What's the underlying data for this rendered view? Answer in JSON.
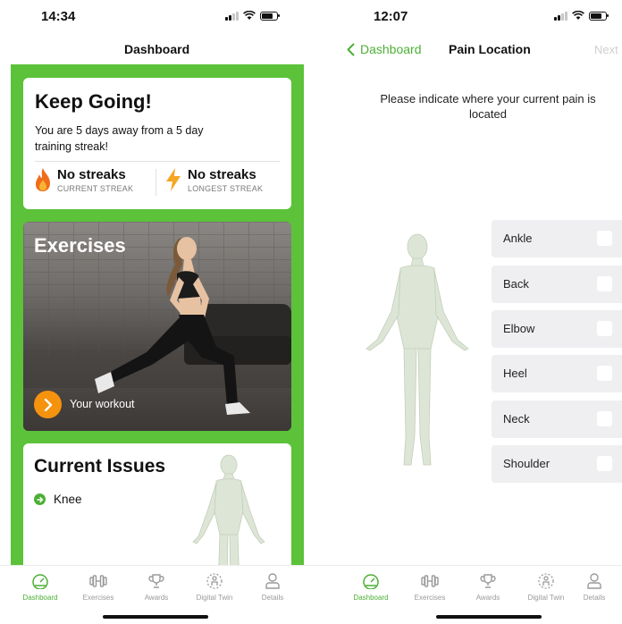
{
  "left": {
    "status_time": "14:34",
    "nav_title": "Dashboard",
    "keep_going": {
      "title": "Keep Going!",
      "subtitle": "You are 5 days away from a 5 day training streak!",
      "current_value": "No streaks",
      "current_label": "CURRENT STREAK",
      "longest_value": "No streaks",
      "longest_label": "LONGEST STREAK"
    },
    "exercises": {
      "title": "Exercises",
      "button_label": "Your workout"
    },
    "issues": {
      "title": "Current Issues",
      "items": [
        "Knee"
      ]
    }
  },
  "right": {
    "status_time": "12:07",
    "back_label": "Dashboard",
    "nav_title": "Pain Location",
    "next_label": "Next",
    "prompt": "Please indicate where your current pain is located",
    "locations": [
      "Ankle",
      "Back",
      "Elbow",
      "Heel",
      "Neck",
      "Shoulder"
    ]
  },
  "tabs": [
    {
      "label": "Dashboard",
      "icon": "dashboard-gauge-icon",
      "active": true
    },
    {
      "label": "Exercises",
      "icon": "dumbbell-icon",
      "active": false
    },
    {
      "label": "Awards",
      "icon": "trophy-icon",
      "active": false
    },
    {
      "label": "Digital Twin",
      "icon": "digital-twin-icon",
      "active": false
    },
    {
      "label": "Details",
      "icon": "person-icon",
      "active": false
    }
  ],
  "colors": {
    "brand_green": "#5bc23a",
    "accent_orange": "#f5920e",
    "tab_active": "#4caf35"
  }
}
